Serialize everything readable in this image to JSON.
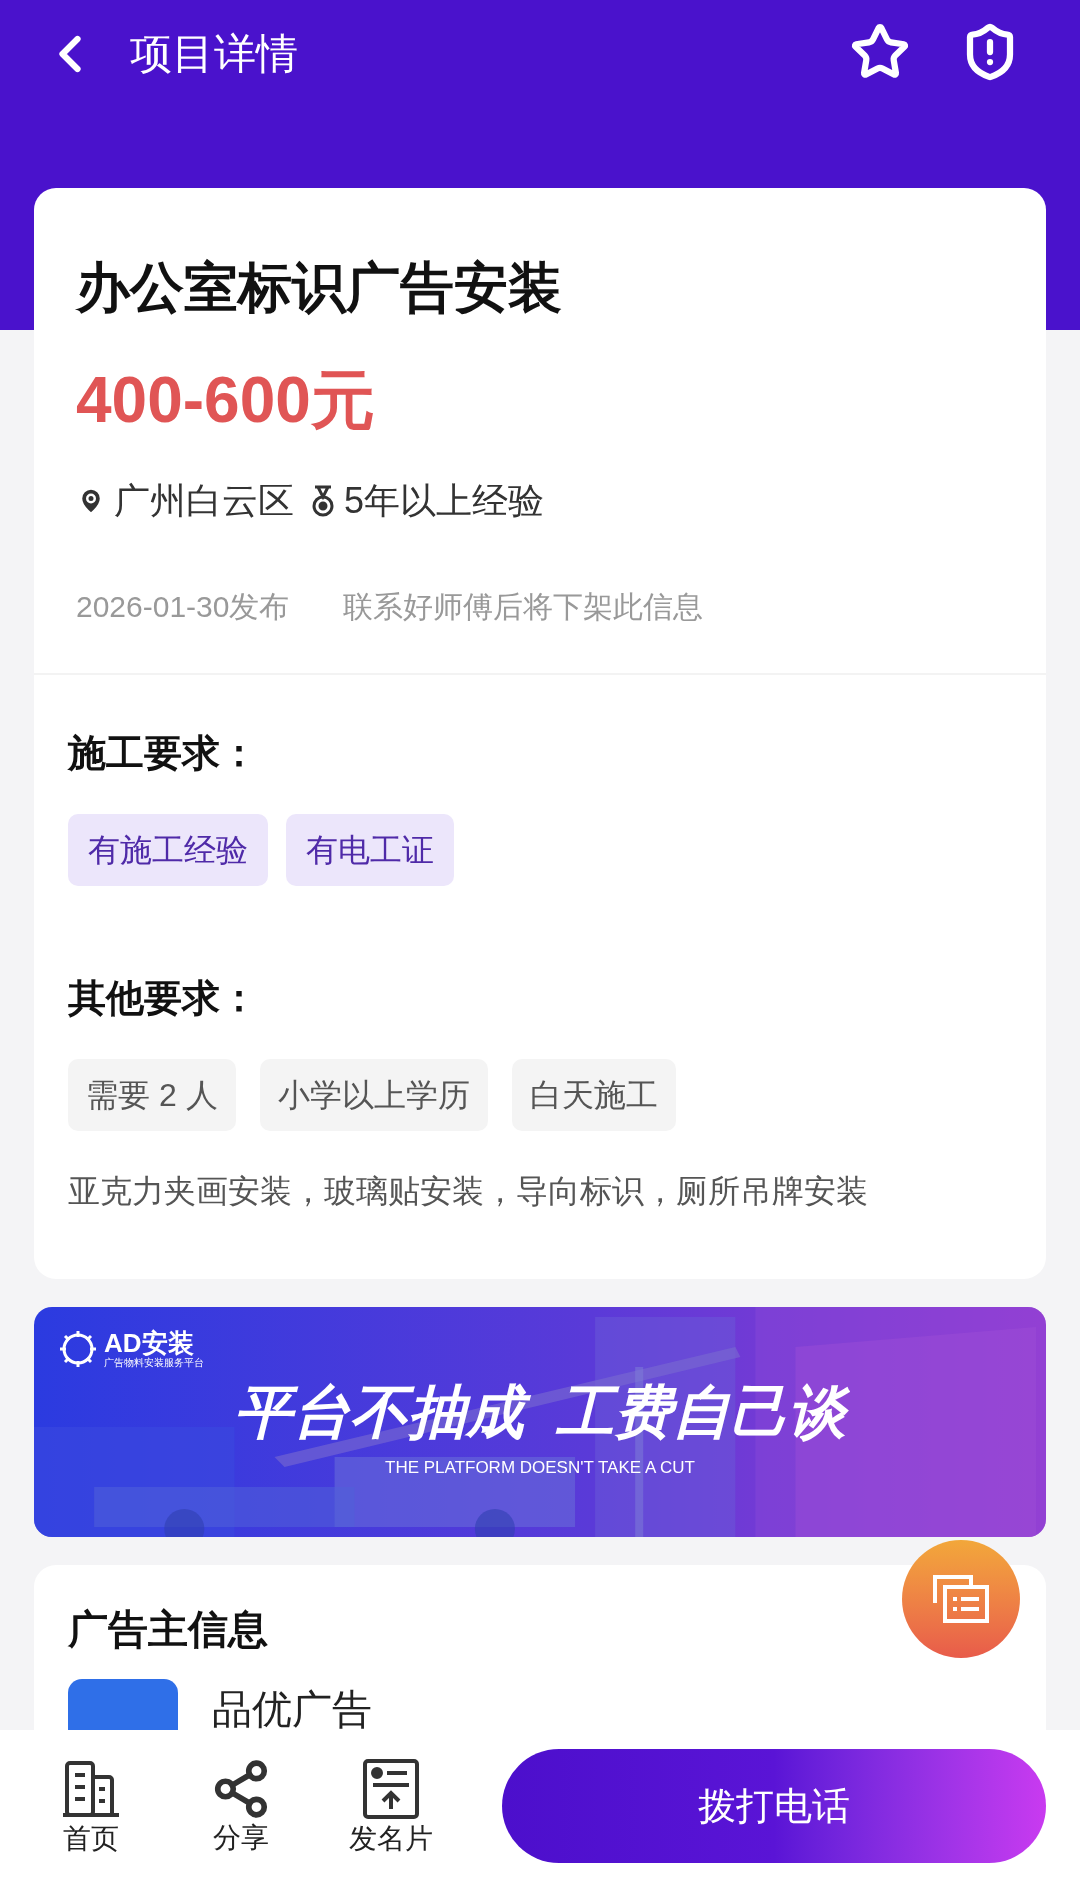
{
  "header": {
    "title": "项目详情"
  },
  "project": {
    "title": "办公室标识广告安装",
    "price": "400-600元",
    "location": "广州白云区",
    "experience": "5年以上经验",
    "published": "2026-01-30发布",
    "notice": "联系好师傅后将下架此信息"
  },
  "construction_requirements": {
    "heading": "施工要求：",
    "tags": [
      "有施工经验",
      "有电工证"
    ]
  },
  "other_requirements": {
    "heading": "其他要求：",
    "tags": [
      "需要 2 人",
      "小学以上学历",
      "白天施工"
    ],
    "description": "亚克力夹画安装，玻璃贴安装，导向标识，厕所吊牌安装"
  },
  "banner": {
    "logo": "AD安装",
    "logo_subtitle": "广告物料安装服务平台",
    "headline": "平台不抽成  工费自己谈",
    "subline": "THE PLATFORM DOESN'T TAKE A CUT"
  },
  "advertiser": {
    "heading": "广告主信息",
    "name": "品优广告"
  },
  "bottom_bar": {
    "items": [
      {
        "label": "首页",
        "kind": "home"
      },
      {
        "label": "分享",
        "kind": "share"
      },
      {
        "label": "发名片",
        "kind": "card"
      }
    ],
    "call_button": "拨打电话"
  }
}
